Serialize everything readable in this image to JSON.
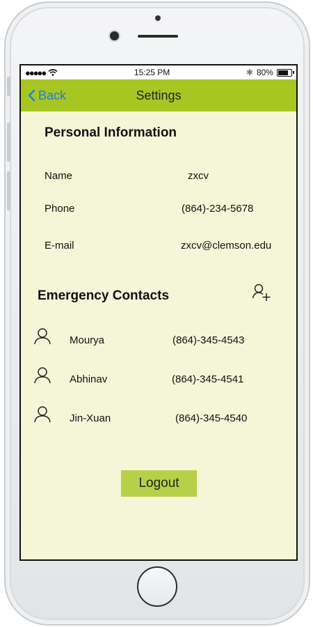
{
  "status_bar": {
    "signal": "●●●●●",
    "time": "15:25 PM",
    "bluetooth": "✱",
    "battery_percent": "80%"
  },
  "nav": {
    "back_label": "Back",
    "title": "Settings"
  },
  "personal": {
    "title": "Personal Information",
    "rows": [
      {
        "label": "Name",
        "value": "zxcv"
      },
      {
        "label": "Phone",
        "value": "(864)-234-5678"
      },
      {
        "label": "E-mail",
        "value": "zxcv@clemson.edu"
      }
    ]
  },
  "emergency": {
    "title": "Emergency Contacts",
    "contacts": [
      {
        "name": "Mourya",
        "phone": "(864)-345-4543"
      },
      {
        "name": "Abhinav",
        "phone": "(864)-345-4541"
      },
      {
        "name": "Jin-Xuan",
        "phone": "(864)-345-4540"
      }
    ]
  },
  "logout_label": "Logout",
  "colors": {
    "navbar": "#a8c622",
    "background": "#f5f6d8",
    "back_link": "#1e7de0",
    "logout_button": "#b7d048"
  }
}
